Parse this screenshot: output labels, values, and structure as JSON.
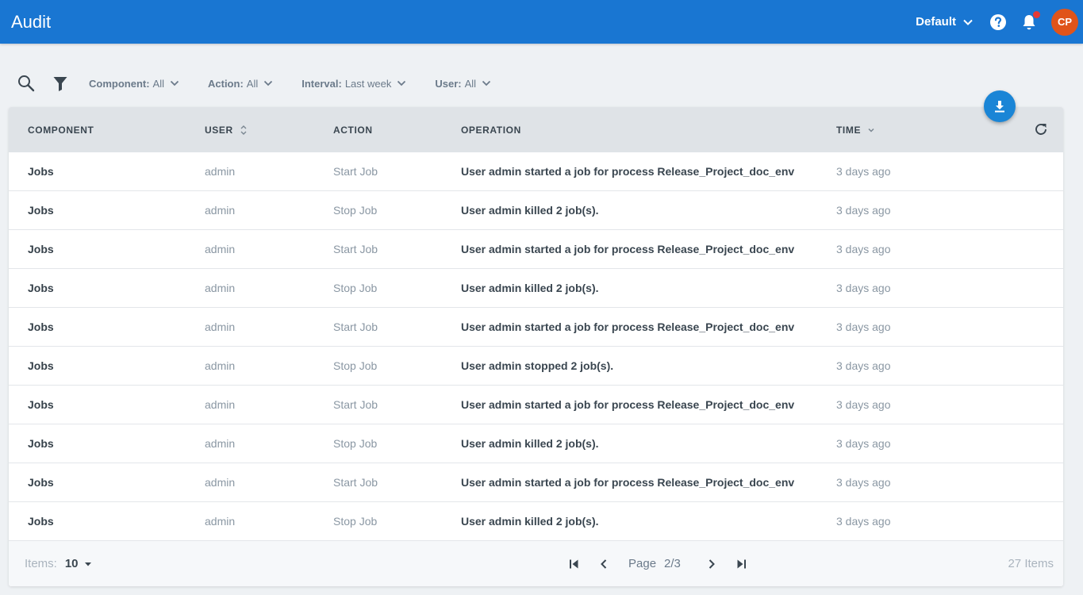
{
  "header": {
    "title": "Audit",
    "workspace": "Default",
    "avatar_initials": "CP",
    "accent": "#1976d2",
    "avatar_color": "#e0541a",
    "notification_dot_color": "#e53935"
  },
  "filters": [
    {
      "label": "Component:",
      "value": "All"
    },
    {
      "label": "Action:",
      "value": "All"
    },
    {
      "label": "Interval:",
      "value": "Last week"
    },
    {
      "label": "User:",
      "value": "All"
    }
  ],
  "table": {
    "columns": {
      "component": "COMPONENT",
      "user": "USER",
      "action": "ACTION",
      "operation": "OPERATION",
      "time": "TIME"
    },
    "rows": [
      {
        "component": "Jobs",
        "user": "admin",
        "action": "Start Job",
        "operation": "User admin started a job for process Release_Project_doc_env",
        "time": "3 days ago"
      },
      {
        "component": "Jobs",
        "user": "admin",
        "action": "Stop Job",
        "operation": "User admin killed 2 job(s).",
        "time": "3 days ago"
      },
      {
        "component": "Jobs",
        "user": "admin",
        "action": "Start Job",
        "operation": "User admin started a job for process Release_Project_doc_env",
        "time": "3 days ago"
      },
      {
        "component": "Jobs",
        "user": "admin",
        "action": "Stop Job",
        "operation": "User admin killed 2 job(s).",
        "time": "3 days ago"
      },
      {
        "component": "Jobs",
        "user": "admin",
        "action": "Start Job",
        "operation": "User admin started a job for process Release_Project_doc_env",
        "time": "3 days ago"
      },
      {
        "component": "Jobs",
        "user": "admin",
        "action": "Stop Job",
        "operation": "User admin stopped 2 job(s).",
        "time": "3 days ago"
      },
      {
        "component": "Jobs",
        "user": "admin",
        "action": "Start Job",
        "operation": "User admin started a job for process Release_Project_doc_env",
        "time": "3 days ago"
      },
      {
        "component": "Jobs",
        "user": "admin",
        "action": "Stop Job",
        "operation": "User admin killed 2 job(s).",
        "time": "3 days ago"
      },
      {
        "component": "Jobs",
        "user": "admin",
        "action": "Start Job",
        "operation": "User admin started a job for process Release_Project_doc_env",
        "time": "3 days ago"
      },
      {
        "component": "Jobs",
        "user": "admin",
        "action": "Stop Job",
        "operation": "User admin killed 2 job(s).",
        "time": "3 days ago"
      }
    ]
  },
  "footer": {
    "items_label": "Items:",
    "items_per_page": "10",
    "page_label": "Page",
    "page_value": "2/3",
    "total": "27 Items"
  }
}
